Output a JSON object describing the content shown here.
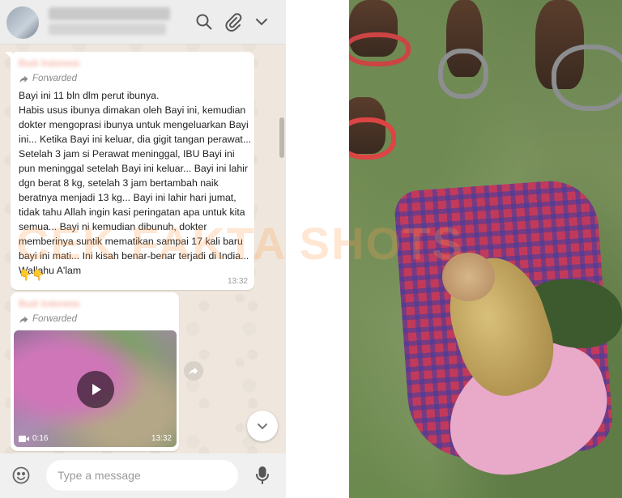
{
  "chat": {
    "header": {
      "icons": [
        "search-icon",
        "paperclip-icon",
        "chevron-down-icon"
      ]
    },
    "messages": [
      {
        "forwarded_label": "Forwarded",
        "text": "Bayi ini 11 bln dlm perut ibunya.\nHabis usus ibunya dimakan oleh Bayi ini, kemudian dokter mengoprasi ibunya untuk mengeluarkan Bayi ini... Ketika Bayi ini keluar, dia gigit tangan perawat... Setelah 3 jam si Perawat meninggal, IBU Bayi ini pun meninggal setelah Bayi ini keluar... Bayi ini lahir dgn berat 8 kg, setelah 3 jam bertambah naik beratnya menjadi 13 kg... Bayi ini lahir hari jumat, tidak tahu Allah ingin kasi peringatan apa untuk kita semua... Bayi ni kemudian dibunuh, dokter memberinya suntik mematikan sampai 17 kali baru bayi ini mati... Ini kisah benar-benar terjadi di India... Wallahu A'lam",
        "emoji": "👇👇",
        "time": "13:32"
      },
      {
        "forwarded_label": "Forwarded",
        "video_duration": "0:16",
        "time": "13:32"
      }
    ],
    "composer": {
      "placeholder": "Type a message"
    }
  },
  "watermark": "CEK FAKTA SHOTS"
}
